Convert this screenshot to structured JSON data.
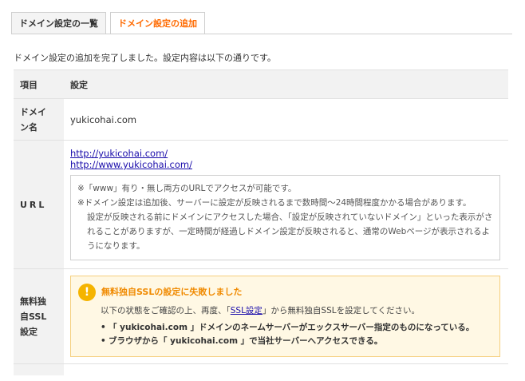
{
  "tabs": [
    {
      "label": "ドメイン設定の一覧",
      "active": false
    },
    {
      "label": "ドメイン設定の追加",
      "active": true
    }
  ],
  "intro": "ドメイン設定の追加を完了しました。設定内容は以下の通りです。",
  "table": {
    "header": {
      "item": "項目",
      "setting": "設定"
    },
    "domain": {
      "label_line1": "ドメイ",
      "label_line2": "ン名",
      "value": "yukicohai.com"
    },
    "url": {
      "label": "URL",
      "links": [
        "http://yukicohai.com/",
        "http://www.yukicohai.com/"
      ],
      "notes": [
        "※「www」有り・無し両方のURLでアクセスが可能です。",
        "※ドメイン設定は追加後、サーバーに設定が反映されるまで数時間〜24時間程度かかる場合があります。"
      ],
      "note_sub": "設定が反映される前にドメインにアクセスした場合、「設定が反映されていないドメイン」といった表示がされることがありますが、一定時間が経過しドメイン設定が反映されると、通常のWebページが表示されるようになります。"
    },
    "ssl": {
      "label_line1": "無料独",
      "label_line2": "自SSL",
      "label_line3": "設定",
      "warning_title": "無料独自SSLの設定に失敗しました",
      "body_prefix": "以下の状態をご確認の上、再度、「",
      "body_link": "SSL設定",
      "body_suffix": "」から無料独自SSLを設定してください。",
      "checks": [
        "「 yukicohai.com 」ドメインのネームサーバーがエックスサーバー指定のものになっている。",
        "ブラウザから「 yukicohai.com 」で当社サーバーへアクセスできる。"
      ]
    }
  },
  "icons": {
    "warning": "exclamation-icon"
  },
  "colors": {
    "accent": "#ff6a00",
    "warning_title": "#f08a00",
    "warning_bg": "#fff8e4",
    "link": "#1a0dab"
  }
}
